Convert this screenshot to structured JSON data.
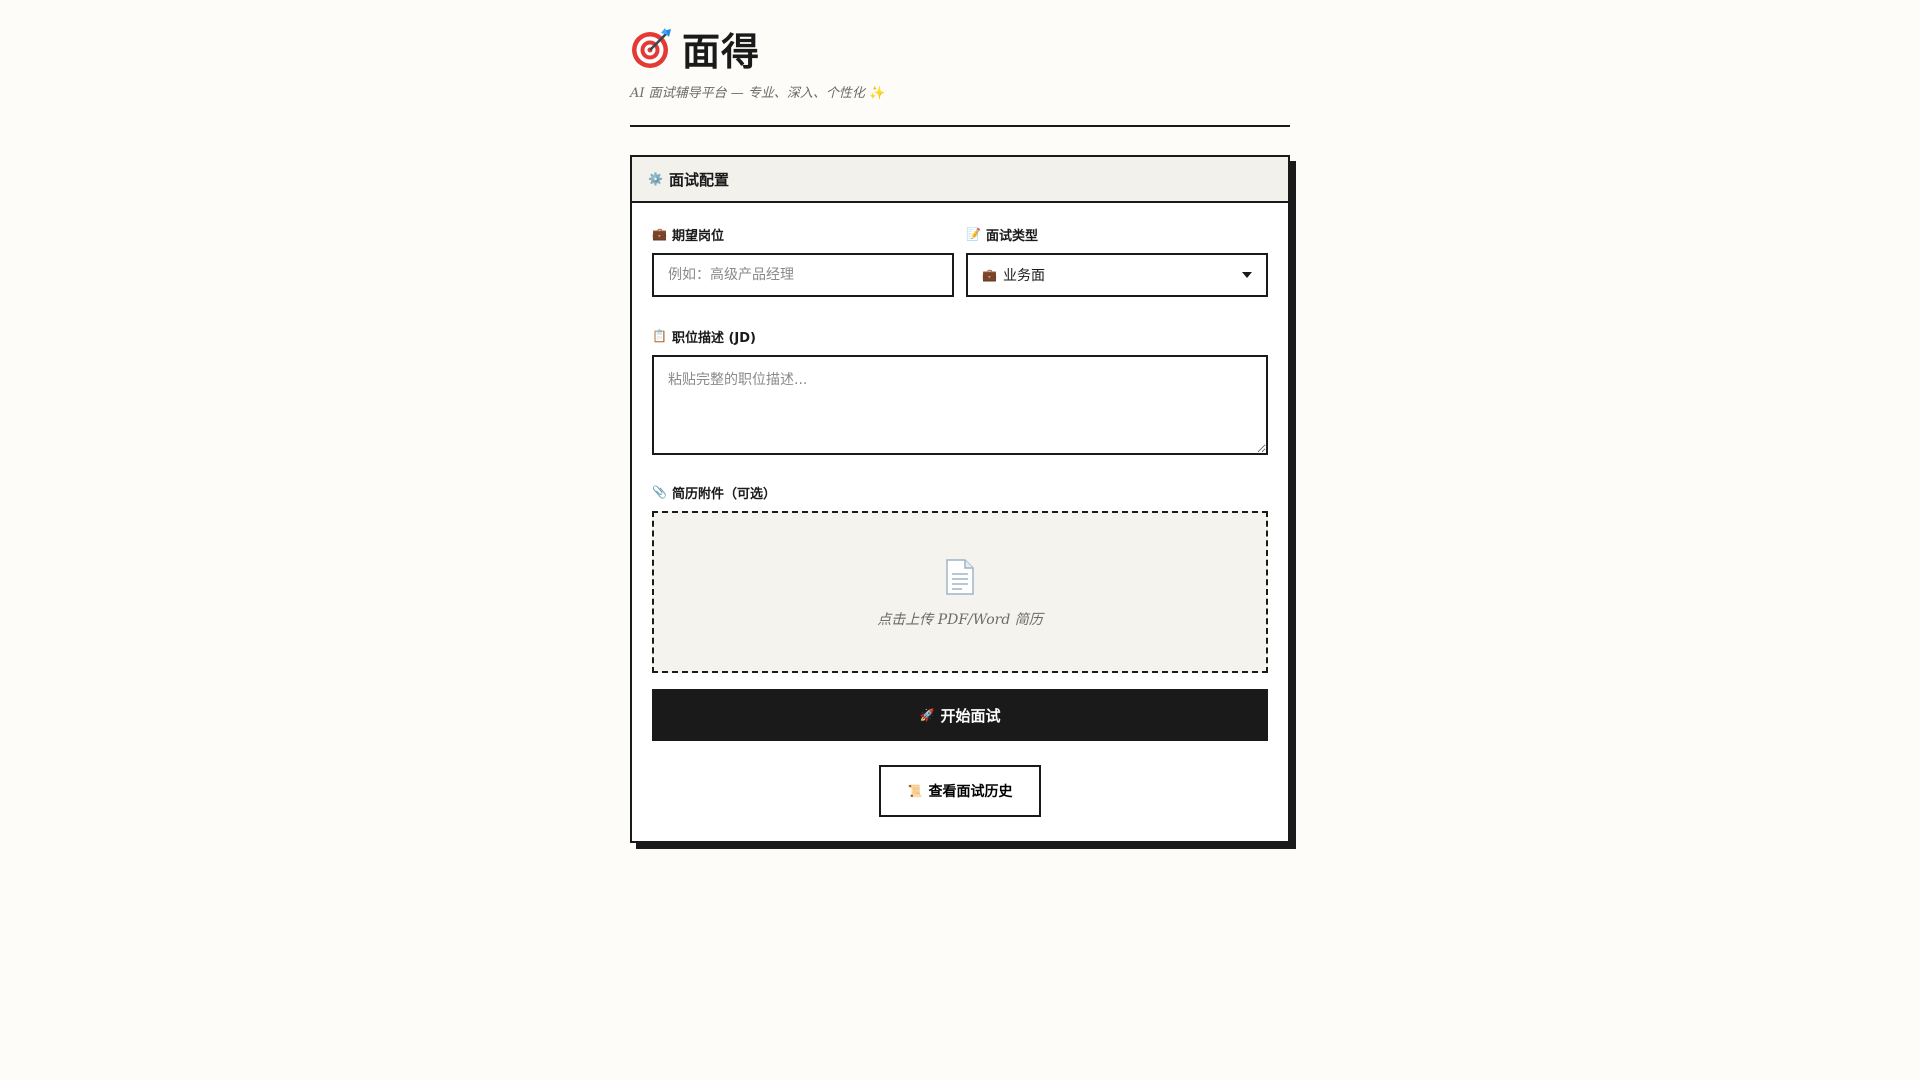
{
  "app": {
    "title": "面得",
    "tagline": "AI 面试辅导平台 — 专业、深入、个性化",
    "tagline_sparkle": "✨",
    "logo_icon": "target-icon"
  },
  "config": {
    "header_icon": "⚙️",
    "header_title": "面试配置",
    "position": {
      "icon": "💼",
      "label": "期望岗位",
      "value": "",
      "placeholder": "例如：高级产品经理"
    },
    "interview_type": {
      "icon": "📝",
      "label": "面试类型",
      "selected_icon": "💼",
      "selected": "业务面"
    },
    "jd": {
      "icon": "📋",
      "label": "职位描述 (JD)",
      "value": "",
      "placeholder": "粘贴完整的职位描述..."
    },
    "resume": {
      "icon": "📎",
      "label": "简历附件（可选）",
      "upload_icon": "document-icon",
      "upload_text": "点击上传 PDF/Word 简历"
    },
    "start_button": {
      "icon": "🚀",
      "label": "开始面试"
    },
    "history_button": {
      "icon": "📜",
      "label": "查看面试历史"
    }
  },
  "colors": {
    "background": "#fdfcf9",
    "ink": "#1a1a1a",
    "panel": "#f3f1ec",
    "muted_text": "#6b6b6b"
  }
}
